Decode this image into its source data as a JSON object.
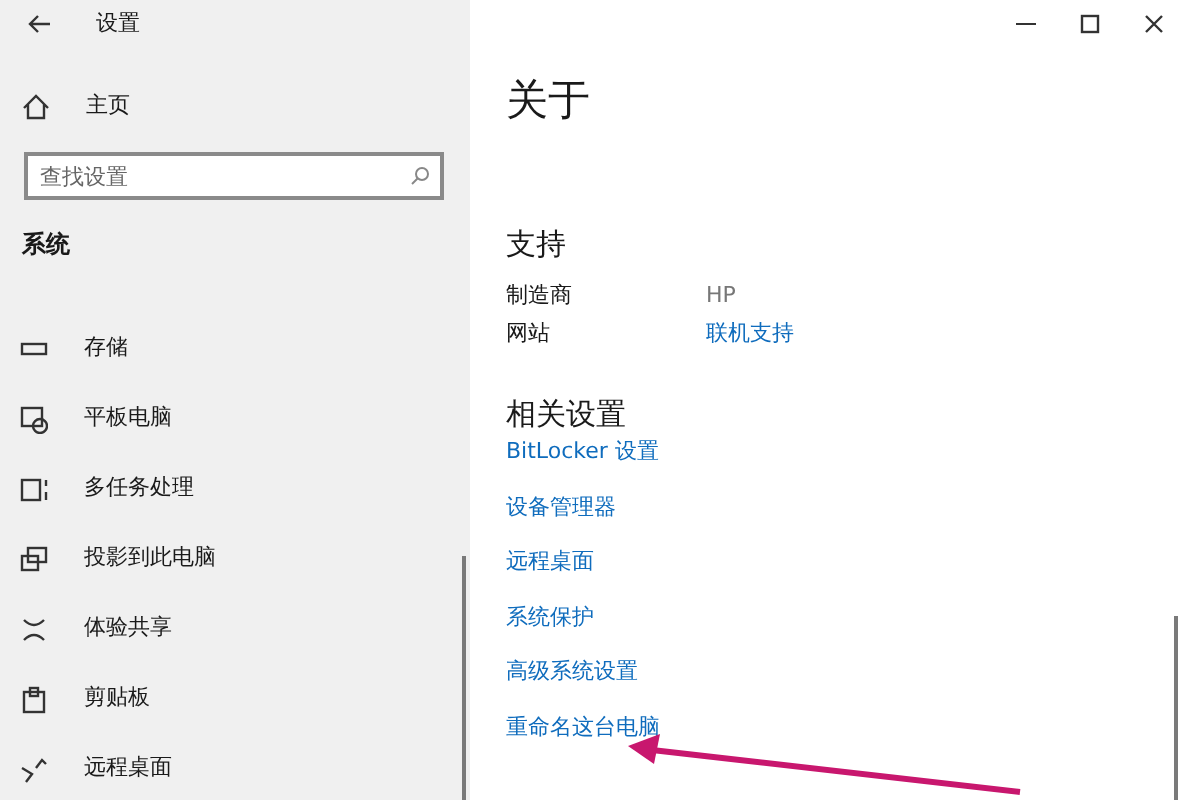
{
  "window": {
    "title": "设置"
  },
  "sidebar": {
    "home": "主页",
    "search": {
      "placeholder": "查找设置"
    },
    "section": "系统",
    "items": [
      {
        "label": "存储"
      },
      {
        "label": "平板电脑"
      },
      {
        "label": "多任务处理"
      },
      {
        "label": "投影到此电脑"
      },
      {
        "label": "体验共享"
      },
      {
        "label": "剪贴板"
      },
      {
        "label": "远程桌面"
      }
    ]
  },
  "page": {
    "title": "关于",
    "support": {
      "heading": "支持",
      "rows": [
        {
          "label": "制造商",
          "value": "HP",
          "kind": "text"
        },
        {
          "label": "网站",
          "value": "联机支持",
          "kind": "link"
        }
      ]
    },
    "related": {
      "heading": "相关设置",
      "links": [
        "BitLocker 设置",
        "设备管理器",
        "远程桌面",
        "系统保护",
        "高级系统设置",
        "重命名这台电脑"
      ]
    }
  }
}
